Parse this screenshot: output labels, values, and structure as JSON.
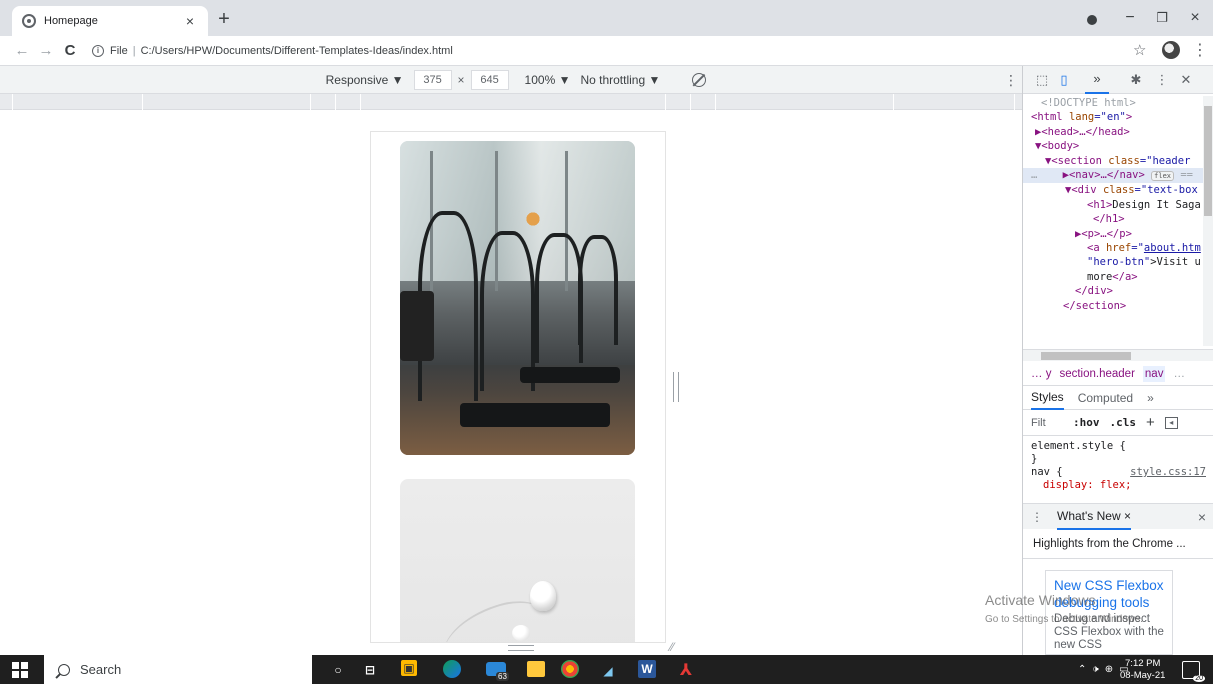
{
  "browser": {
    "tab_title": "Homepage",
    "tab_close": "×",
    "new_tab": "+",
    "window": {
      "minimize": "−",
      "restore": "❐",
      "close": "×"
    },
    "back": "←",
    "forward": "→",
    "reload": "C",
    "address_prefix": "File",
    "address_sep": "|",
    "address_path": "C:/Users/HPW/Documents/Different-Templates-Ideas/index.html",
    "bookmark_star": "☆",
    "menu": "⋮"
  },
  "device_toolbar": {
    "mode": "Responsive ▼",
    "width": "375",
    "times": "×",
    "height": "645",
    "zoom": "100% ▼",
    "throttling": "No throttling ▼",
    "more": "⋮"
  },
  "devtools": {
    "more_tabs": "»",
    "dom_lines": {
      "l1": "<!DOCTYPE html>",
      "l2a": "<html ",
      "l2b": "lang",
      "l2c": "=\"en\"",
      "l2d": ">",
      "l3": "▶<head>…</head>",
      "l4": "▼<body>",
      "l5a": "▼<section ",
      "l5b": "class",
      "l5c": "=\"header",
      "l6a": "▶<nav>…</nav>",
      "l6b": "flex",
      "l6c": "==",
      "l7a": "▼<div ",
      "l7b": "class",
      "l7c": "=\"text-box",
      "l8a": "<h1>",
      "l8b": "Design It Saga",
      "l9": "</h1>",
      "l10": "▶<p>…</p>",
      "l11a": "<a ",
      "l11b": "href",
      "l11c": "=\"",
      "l11d": "about.htm",
      "l12a": "\"hero-btn\"",
      "l12b": ">Visit u",
      "l13a": "more",
      "l13b": "</a>",
      "l14": "</div>",
      "l15": "</section>",
      "ellipsis": "…"
    },
    "breadcrumb": {
      "lead": "… y",
      "section": "section.header",
      "nav": "nav",
      "trail": "…"
    },
    "styles_tab": "Styles",
    "computed_tab": "Computed",
    "styles_more": "»",
    "filter_placeholder": "Filt",
    "hov": ":hov",
    "cls": ".cls",
    "plus": "+",
    "rules": {
      "element_style": "element.style {",
      "close_brace": "}",
      "nav_selector": "nav {",
      "nav_source": "style.css:17",
      "nav_prop": "display: flex;"
    },
    "whats_new_tab": "What's New ×",
    "drawer_menu": "⋮",
    "drawer_close": "×",
    "highlights": "Highlights from the Chrome ...",
    "card_title": "New CSS Flexbox debugging tools",
    "card_desc": "Debug and inspect CSS Flexbox with the new CSS"
  },
  "watermark": {
    "title": "Activate Windows",
    "subtitle": "Go to Settings to activate Windows."
  },
  "taskbar": {
    "search_label": "Search",
    "badge": "63",
    "clock_time": "7:12 PM",
    "clock_date": "08-May-21",
    "notifications": "20"
  }
}
